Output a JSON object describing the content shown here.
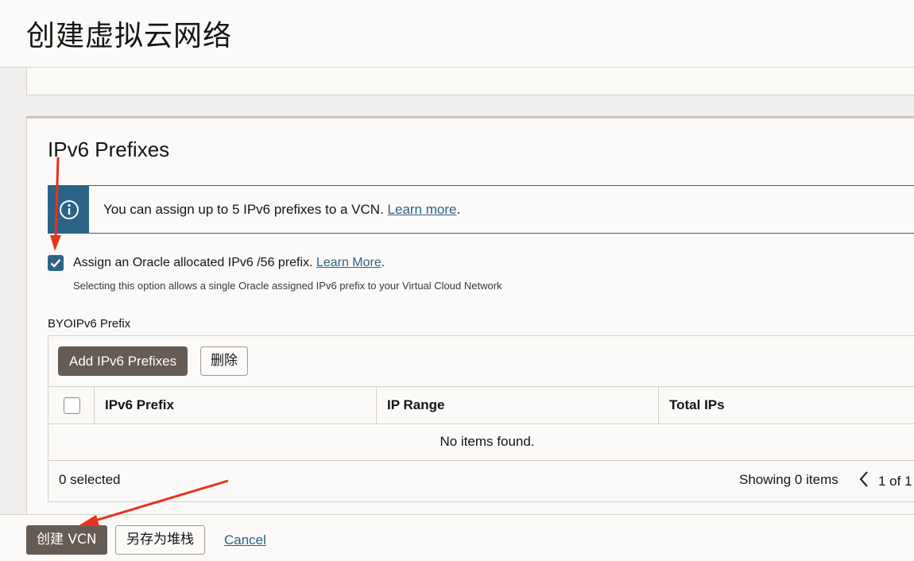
{
  "header": {
    "title": "创建虚拟云网络"
  },
  "section": {
    "title": "IPv6 Prefixes",
    "info": {
      "text": "You can assign up to 5 IPv6 prefixes to a VCN. ",
      "link": "Learn more",
      "suffix": "."
    },
    "assign_checkbox": {
      "checked": true,
      "label": "Assign an Oracle allocated IPv6 /56 prefix. ",
      "link": "Learn More",
      "suffix": ".",
      "help": "Selecting this option allows a single Oracle assigned IPv6 prefix to your Virtual Cloud Network"
    },
    "byoip_label": "BYOIPv6 Prefix",
    "table": {
      "add_button": "Add IPv6 Prefixes",
      "delete_button": "删除",
      "columns": [
        "IPv6 Prefix",
        "IP Range",
        "Total IPs"
      ],
      "empty_text": "No items found.",
      "selected_text": "0 selected",
      "showing_text": "Showing 0 items",
      "page_text": "1 of 1"
    }
  },
  "footer": {
    "create_button": "创建 VCN",
    "save_stack_button": "另存为堆栈",
    "cancel_link": "Cancel"
  },
  "icons": {
    "info": "info-icon",
    "check": "check-icon",
    "prev": "chevron-left-icon"
  },
  "colors": {
    "accent": "#2b6387",
    "primary_button": "#645c55",
    "annotation_arrow": "#e8321e"
  }
}
